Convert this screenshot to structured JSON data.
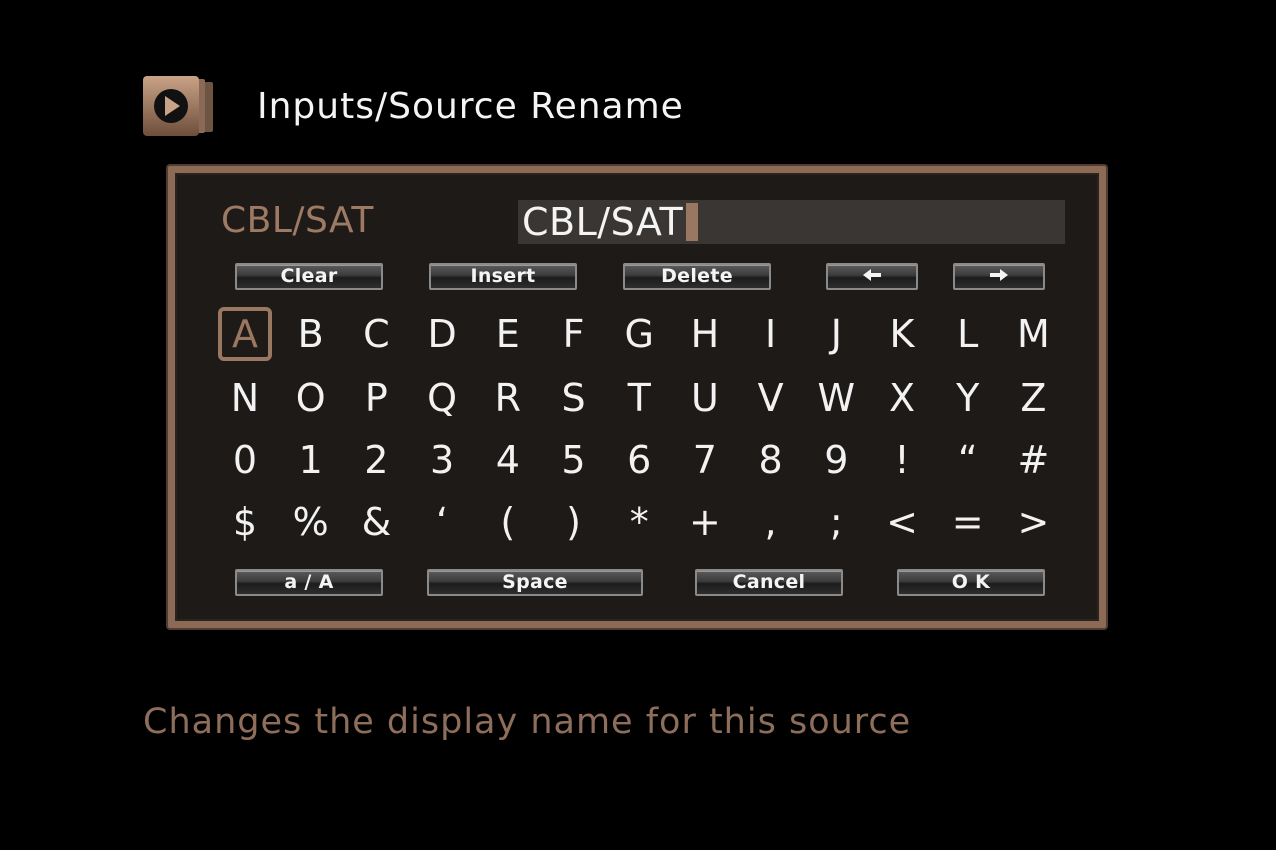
{
  "header": {
    "title": "Inputs/Source Rename",
    "icon": "menu-arrow-icon"
  },
  "editor": {
    "source_label": "CBL/SAT",
    "field_value": "CBL/SAT"
  },
  "controls": {
    "clear": "Clear",
    "insert": "Insert",
    "delete": "Delete",
    "left_icon": "arrow-left-icon",
    "right_icon": "arrow-right-icon"
  },
  "keyboard": {
    "rows": [
      [
        "A",
        "B",
        "C",
        "D",
        "E",
        "F",
        "G",
        "H",
        "I",
        "J",
        "K",
        "L",
        "M"
      ],
      [
        "N",
        "O",
        "P",
        "Q",
        "R",
        "S",
        "T",
        "U",
        "V",
        "W",
        "X",
        "Y",
        "Z"
      ],
      [
        "0",
        "1",
        "2",
        "3",
        "4",
        "5",
        "6",
        "7",
        "8",
        "9",
        "!",
        "“",
        "#"
      ],
      [
        "$",
        "%",
        "&",
        "‘",
        "(",
        ")",
        "*",
        "+",
        ",",
        ";",
        "<",
        "=",
        ">"
      ]
    ],
    "selected": "A"
  },
  "actions": {
    "case": "a / A",
    "space": "Space",
    "cancel": "Cancel",
    "ok": "O K"
  },
  "help": "Changes the display name for this source",
  "colors": {
    "accent": "#9a7760",
    "frame": "#8c6a55",
    "panel_bg": "#1e1a18"
  }
}
